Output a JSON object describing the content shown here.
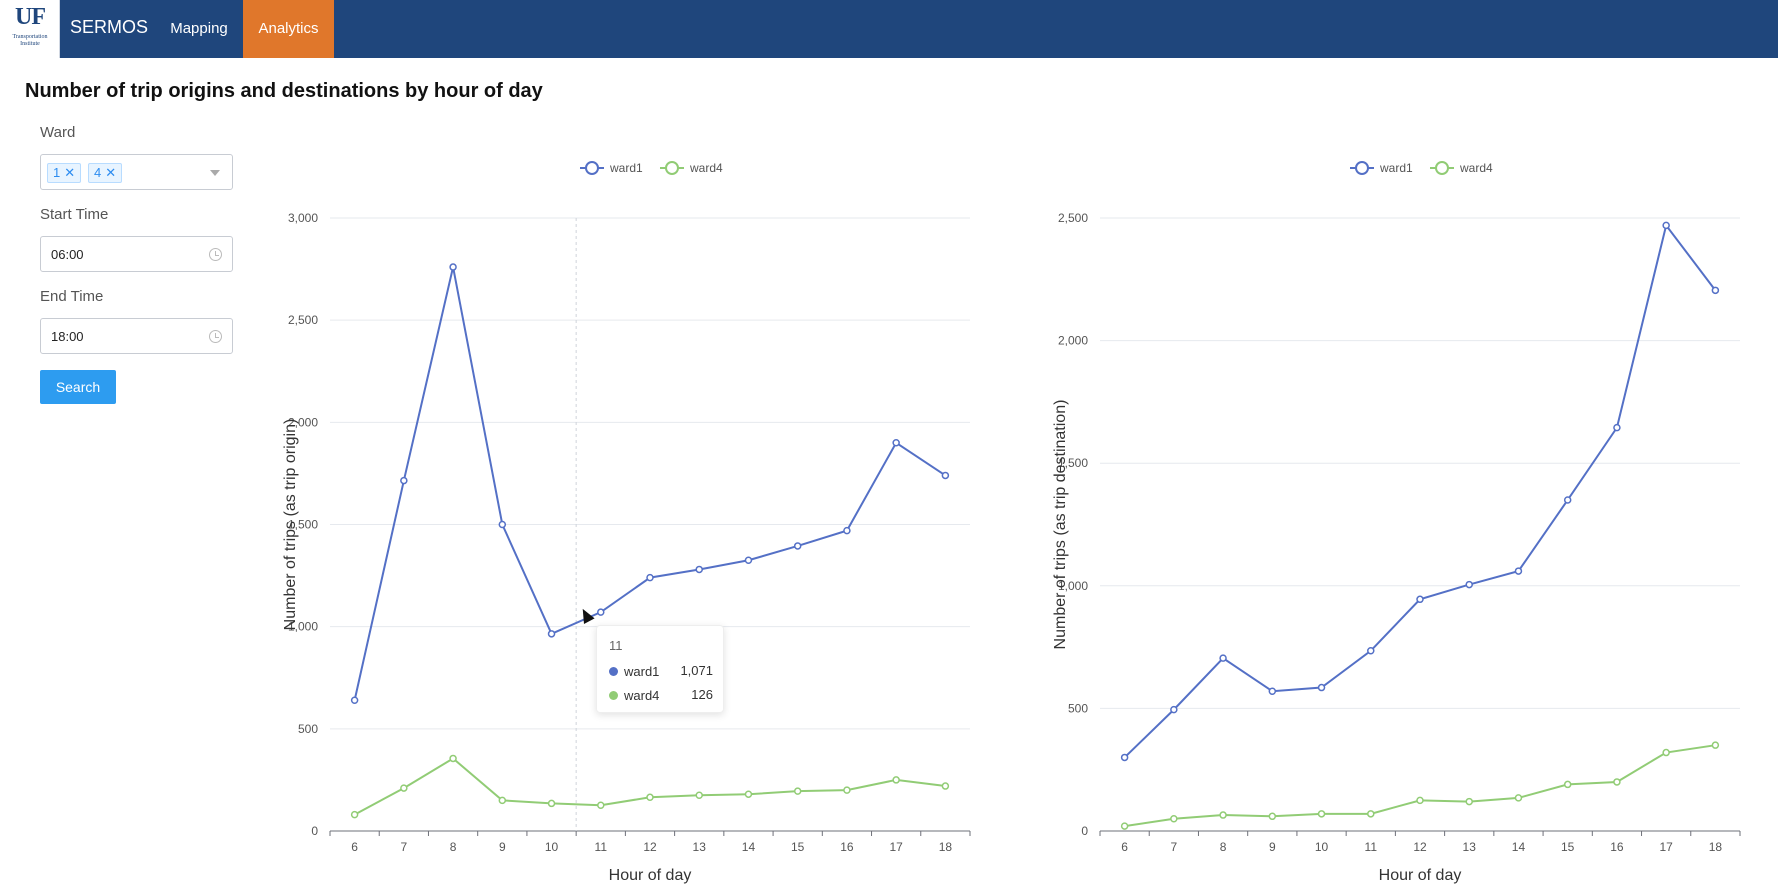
{
  "header": {
    "logo": "UF",
    "logo_sub": "Transportation Institute",
    "brand": "SERMOS",
    "nav": [
      {
        "label": "Mapping"
      },
      {
        "label": "Analytics"
      }
    ]
  },
  "page_title": "Number of trip origins and destinations by hour of day",
  "filters": {
    "ward_label": "Ward",
    "ward_tags": [
      "1",
      "4"
    ],
    "start_label": "Start Time",
    "start_value": "06:00",
    "end_label": "End Time",
    "end_value": "18:00",
    "search_label": "Search"
  },
  "colors": {
    "ward1": "#5470c6",
    "ward4": "#91cc75"
  },
  "tooltip": {
    "title": "11",
    "rows": [
      {
        "name": "ward1",
        "value": "1,071"
      },
      {
        "name": "ward4",
        "value": "126"
      }
    ]
  },
  "chart_data": [
    {
      "type": "line",
      "ylabel": "Number of trips (as trip origin)",
      "xlabel": "Hour of day",
      "categories": [
        "6",
        "7",
        "8",
        "9",
        "10",
        "11",
        "12",
        "13",
        "14",
        "15",
        "16",
        "17",
        "18"
      ],
      "ylim": [
        0,
        3000
      ],
      "yticks": [
        0,
        500,
        1000,
        1500,
        2000,
        2500,
        3000
      ],
      "ytick_labels": [
        "0",
        "500",
        "1,000",
        "1,500",
        "2,000",
        "2,500",
        "3,000"
      ],
      "legend": "top-center",
      "series": [
        {
          "name": "ward1",
          "values": [
            640,
            1715,
            2760,
            1500,
            965,
            1071,
            1240,
            1280,
            1325,
            1395,
            1470,
            1900,
            1740
          ]
        },
        {
          "name": "ward4",
          "values": [
            80,
            210,
            355,
            150,
            135,
            126,
            165,
            175,
            180,
            195,
            200,
            250,
            220
          ]
        }
      ]
    },
    {
      "type": "line",
      "ylabel": "Number of trips (as trip destination)",
      "xlabel": "Hour of day",
      "categories": [
        "6",
        "7",
        "8",
        "9",
        "10",
        "11",
        "12",
        "13",
        "14",
        "15",
        "16",
        "17",
        "18"
      ],
      "ylim": [
        0,
        2500
      ],
      "yticks": [
        0,
        500,
        1000,
        1500,
        2000,
        2500
      ],
      "ytick_labels": [
        "0",
        "500",
        "1,000",
        "1,500",
        "2,000",
        "2,500"
      ],
      "legend": "top-center",
      "series": [
        {
          "name": "ward1",
          "values": [
            300,
            495,
            705,
            570,
            585,
            735,
            945,
            1005,
            1060,
            1350,
            1645,
            2470,
            2205
          ]
        },
        {
          "name": "ward4",
          "values": [
            20,
            50,
            65,
            60,
            70,
            70,
            125,
            120,
            135,
            190,
            200,
            320,
            350
          ]
        }
      ]
    }
  ]
}
